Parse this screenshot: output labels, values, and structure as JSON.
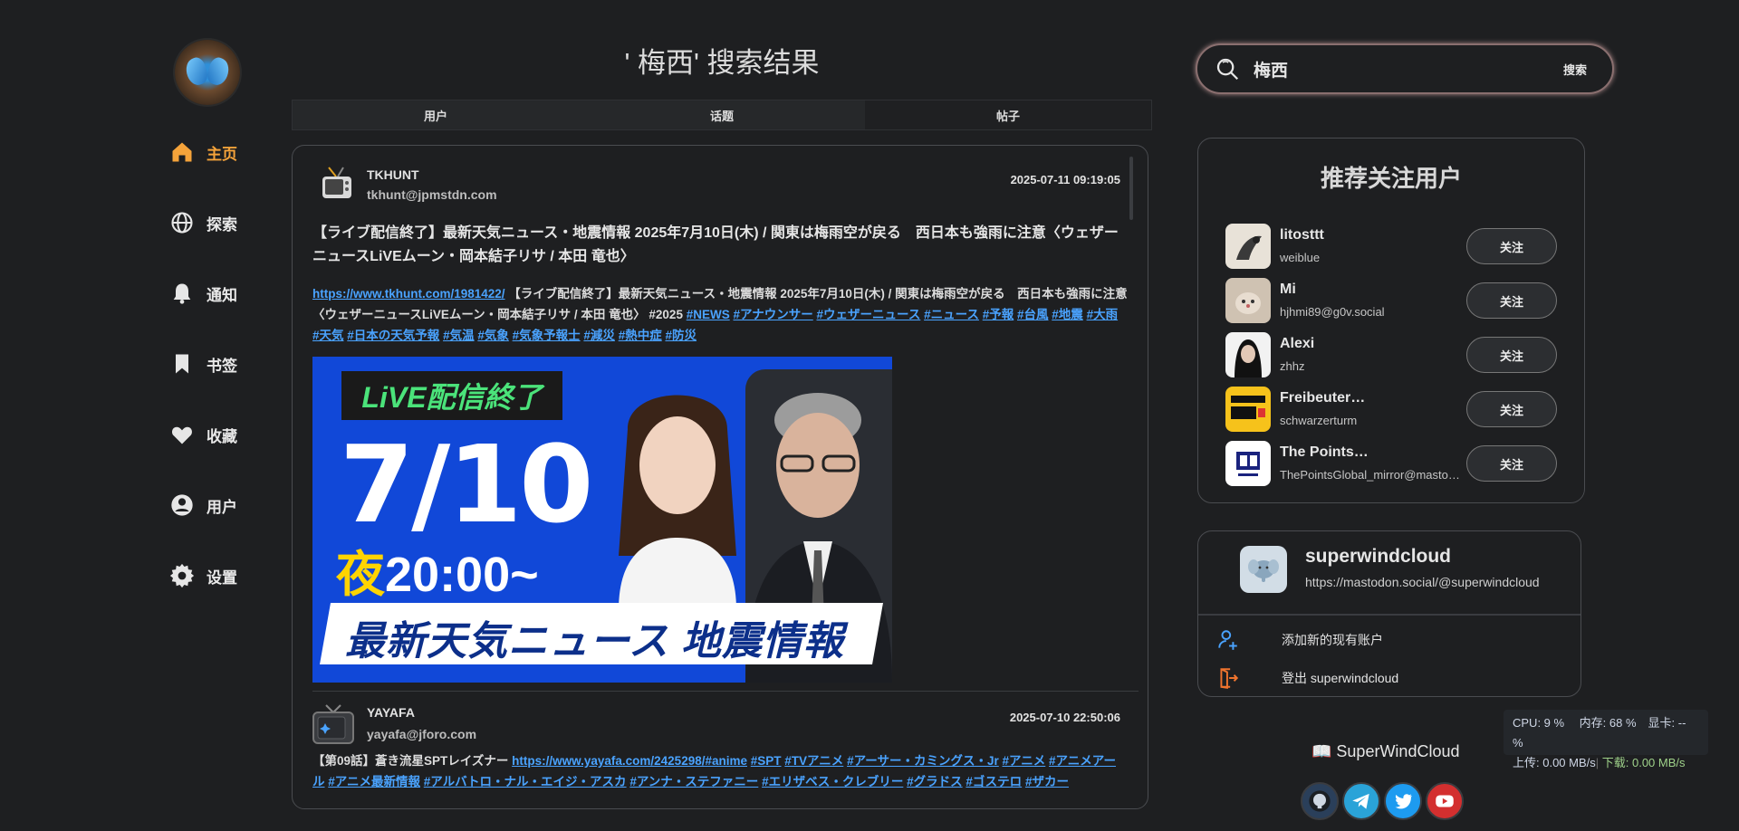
{
  "nav": {
    "items": [
      {
        "label": "主页",
        "icon": "home-icon",
        "active": true
      },
      {
        "label": "探索",
        "icon": "globe-icon"
      },
      {
        "label": "通知",
        "icon": "bell-icon"
      },
      {
        "label": "书签",
        "icon": "bookmark-icon"
      },
      {
        "label": "收藏",
        "icon": "heart-icon"
      },
      {
        "label": "用户",
        "icon": "user-circle-icon"
      },
      {
        "label": "设置",
        "icon": "gear-icon"
      }
    ]
  },
  "main": {
    "title": "' 梅西' 搜索结果",
    "tabs": [
      {
        "label": "用户"
      },
      {
        "label": "话题"
      },
      {
        "label": "帖子",
        "active": true
      }
    ],
    "posts": [
      {
        "name": "TKHUNT",
        "handle": "tkhunt@jpmstdn.com",
        "time": "2025-07-11 09:19:05",
        "title": "【ライブ配信終了】最新天気ニュース・地震情報 2025年7月10日(木) / 関東は梅雨空が戻る　西日本も強雨に注意〈ウェザーニュースLiVEムーン・岡本結子リサ / 本田 竜也〉",
        "link": "https://www.tkhunt.com/1981422/",
        "body_text": " 【ライブ配信終了】最新天気ニュース・地震情報 2025年7月10日(木) / 関東は梅雨空が戻る　西日本も強雨に注意〈ウェザーニュースLiVEムーン・岡本結子リサ / 本田 竜也〉 #2025 ",
        "tags": [
          "#NEWS",
          "#アナウンサー",
          "#ウェザーニュース",
          "#ニュース",
          "#予報",
          "#台風",
          "#地震",
          "#大雨",
          "#天気",
          "#日本の天気予報",
          "#気温",
          "#気象",
          "#気象予報士",
          "#減災",
          "#熱中症",
          "#防災"
        ],
        "image": {
          "live_label": "LiVE配信終了",
          "date": "7/10",
          "time_prefix": "夜",
          "time": "20:00~",
          "banner": "最新天気ニュース 地震情報"
        }
      },
      {
        "name": "YAYAFA",
        "handle": "yayafa@jforo.com",
        "time": "2025-07-10 22:50:06",
        "body_prefix": "【第09話】蒼き流星SPTレイズナー ",
        "link": "https://www.yayafa.com/2425298/",
        "tags": [
          "#anime",
          "#SPT",
          "#TVアニメ",
          "#アーサー・カミングス・Jr",
          "#アニメ",
          "#アニメアール",
          "#アニメ最新情報",
          "#アルバトロ・ナル・エイジ・アスカ",
          "#アンナ・ステファニー",
          "#エリザベス・クレブリー",
          "#グラドス",
          "#ゴステロ",
          "#ザカー"
        ]
      }
    ]
  },
  "search": {
    "value": "梅西",
    "button_label": "搜索"
  },
  "recommend": {
    "title": "推荐关注用户",
    "follow_label": "关注",
    "users": [
      {
        "name": "litosttt",
        "handle": "weiblue"
      },
      {
        "name": "Mi",
        "handle": "hjhmi89@g0v.social"
      },
      {
        "name": "Alexi",
        "handle": "zhhz"
      },
      {
        "name": "Freibeuter…",
        "handle": "schwarzerturm"
      },
      {
        "name": "The Points…",
        "handle": "ThePointsGlobal_mirror@masto…"
      }
    ]
  },
  "account": {
    "name": "superwindcloud",
    "url": "https://mastodon.social/@superwindcloud",
    "add_label": "添加新的现有账户",
    "logout_label": "登出 superwindcloud"
  },
  "stats": {
    "line1": "CPU: 9 %　 内存: 68 %　显卡: -- %",
    "upload": "上传: 0.00 MB/s",
    "download": "下载: 0.00 MB/s"
  },
  "footer": {
    "brand": "📖 SuperWindCloud",
    "social": [
      "github-icon",
      "telegram-icon",
      "twitter-icon",
      "youtube-icon"
    ]
  },
  "colors": {
    "background": "#1e1f21",
    "accent": "#f5a33a",
    "link": "#4aa3ff"
  }
}
